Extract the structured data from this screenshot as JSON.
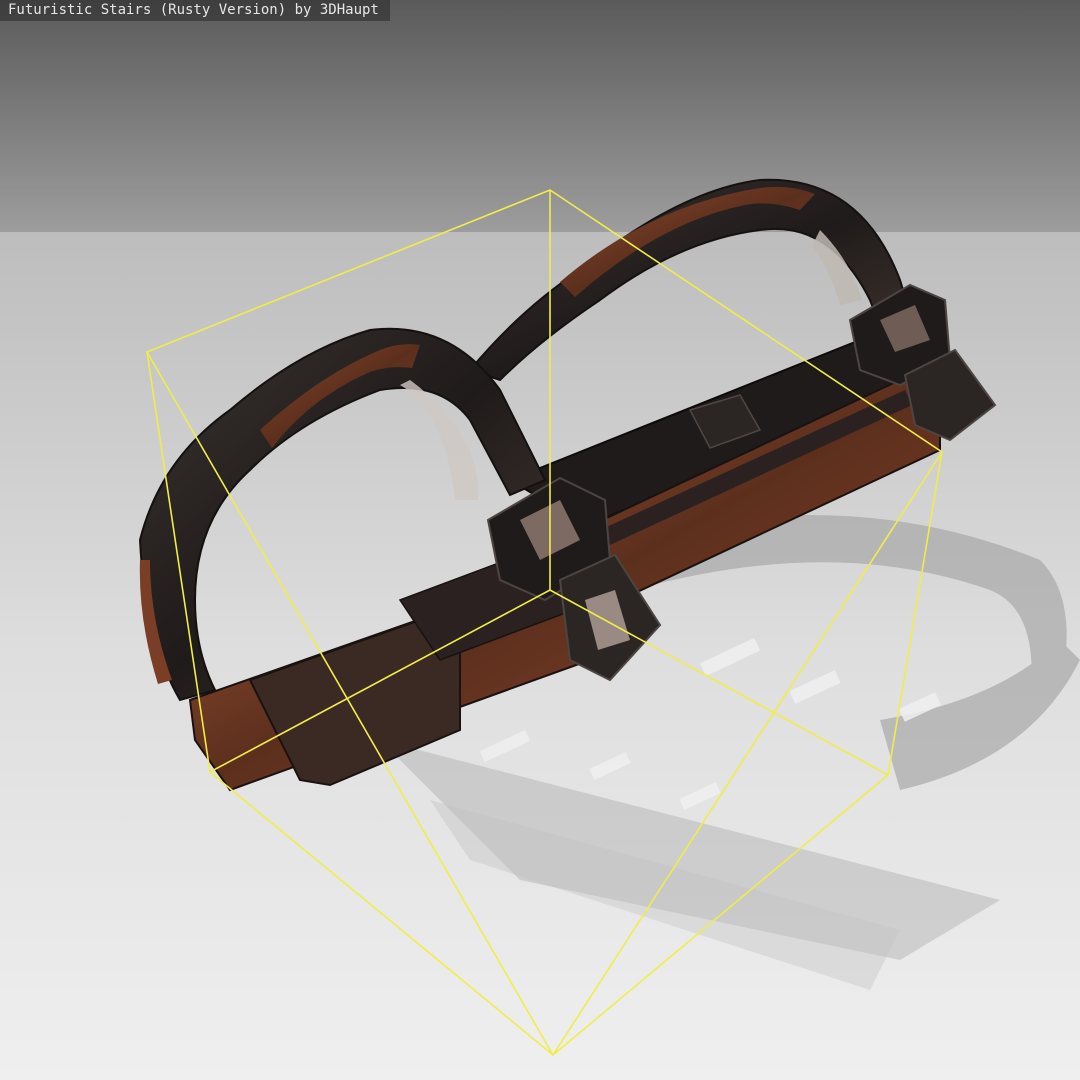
{
  "viewer": {
    "title": "Futuristic Stairs (Rusty Version) by 3DHaupt"
  },
  "scene": {
    "model_name": "futuristic-stairs-rusty",
    "bounding_box_color": "#f2ec4a",
    "background_top_color": "#5a5a5a",
    "floor_color": "#ececec",
    "material_colors": {
      "dark_metal": "#2a2624",
      "rust": "#7a3e26",
      "highlight": "#c9c4c0"
    }
  }
}
